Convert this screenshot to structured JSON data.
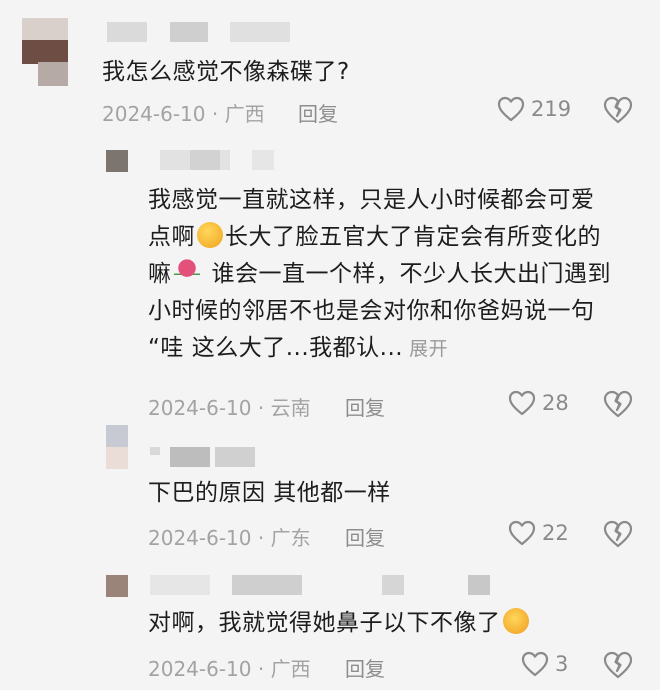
{
  "comments": [
    {
      "text": "我怎么感觉不像森碟了?",
      "date_location": "2024-6-10 · 广西",
      "reply_label": "回复",
      "likes": "219"
    },
    {
      "text_lines": [
        "我感觉一直就这样，只是人小时候都会可爱",
        "点啊",
        "长大了脸五官大了肯定会有所变化的",
        "嘛",
        "谁会一直一个样，不少人长大出门遇到",
        "小时候的邻居不也是会对你和你爸妈说一句",
        "“哇 这么大了...我都认..."
      ],
      "expand_label": "展开",
      "date_location": "2024-6-10 · 云南",
      "reply_label": "回复",
      "likes": "28"
    },
    {
      "text": "下巴的原因 其他都一样",
      "date_location": "2024-6-10 · 广东",
      "reply_label": "回复",
      "likes": "22"
    },
    {
      "text": "对啊，我就觉得她鼻子以下不像了",
      "date_location": "2024-6-10 · 广西",
      "reply_label": "回复",
      "likes": "3"
    }
  ],
  "icons": {
    "like": "heart-outline-icon",
    "dislike": "broken-heart-icon",
    "emoji_wink": "winking-face-icon",
    "emoji_rose": "rose-icon",
    "emoji_laugh": "rolling-laughing-face-icon"
  },
  "colors": {
    "background": "#f4f4f4",
    "text": "#1d1d1d",
    "meta": "#a3a3a3",
    "icon": "#8a8a8a"
  }
}
